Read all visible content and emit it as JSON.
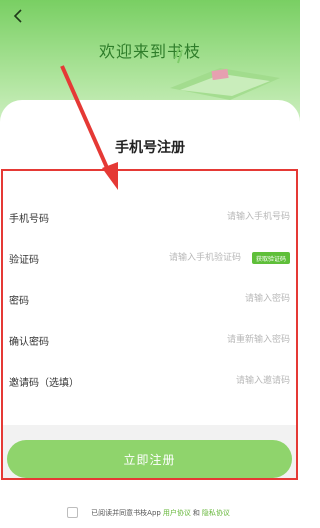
{
  "header": {
    "back_icon": "chevron-left-icon",
    "welcome": "欢迎来到书枝"
  },
  "page_title": "手机号注册",
  "form": {
    "phone": {
      "label": "手机号码",
      "placeholder": "请输入手机号码"
    },
    "code": {
      "label": "验证码",
      "placeholder": "请输入手机验证码",
      "button": "获取验证码"
    },
    "password": {
      "label": "密码",
      "placeholder": "请输入密码"
    },
    "confirm": {
      "label": "确认密码",
      "placeholder": "请重新输入密码"
    },
    "invite": {
      "label": "邀请码（选填）",
      "placeholder": "请输入邀请码"
    }
  },
  "submit_label": "立即注册",
  "agreement": {
    "prefix": "已阅读并同意书枝App",
    "user_link": "用户协议",
    "and": "和",
    "privacy_link": "隐私协议"
  },
  "colors": {
    "brand_green": "#66b73a",
    "highlight_red": "#e53935"
  }
}
